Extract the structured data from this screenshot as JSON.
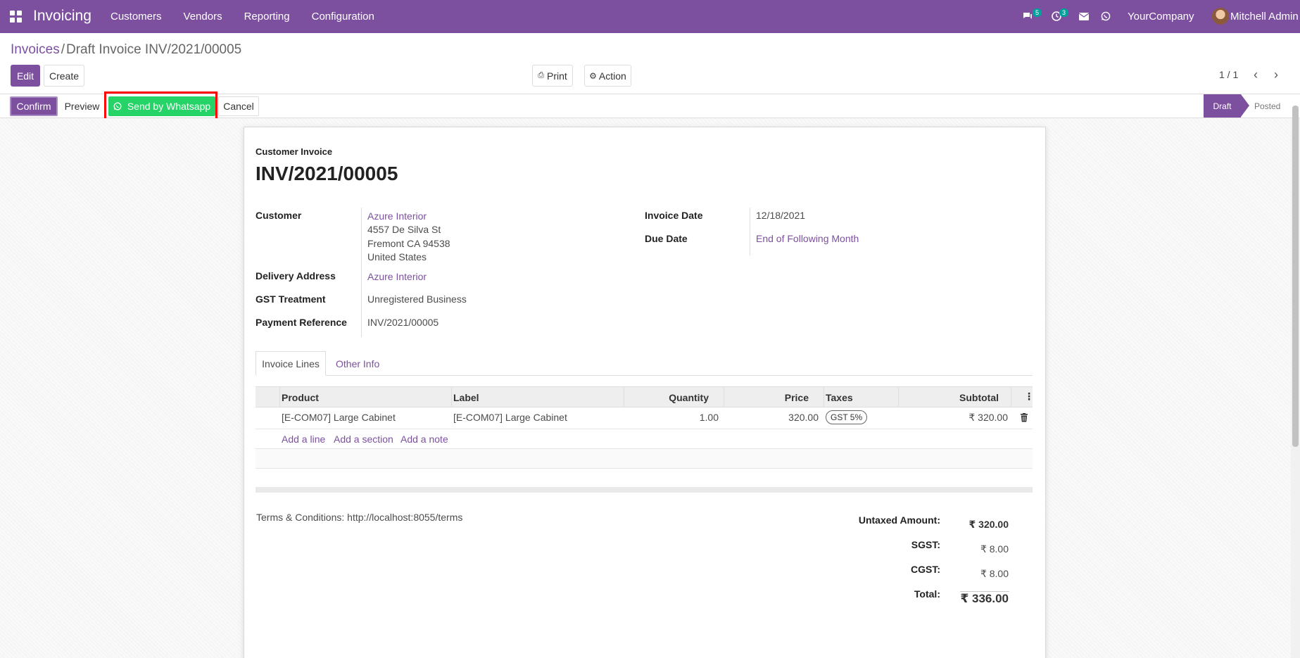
{
  "navbar": {
    "app_title": "Invoicing",
    "menu": [
      "Customers",
      "Vendors",
      "Reporting",
      "Configuration"
    ],
    "chat_badge": "5",
    "activity_badge": "3",
    "company": "YourCompany",
    "user": "Mitchell Admin"
  },
  "breadcrumb": {
    "parent": "Invoices",
    "separator": "/",
    "current": "Draft Invoice INV/2021/00005"
  },
  "control": {
    "edit": "Edit",
    "create": "Create",
    "print": "Print",
    "action": "Action",
    "pager": "1 / 1"
  },
  "statusbar": {
    "confirm": "Confirm",
    "preview": "Preview",
    "whatsapp": "Send by Whatsapp",
    "cancel": "Cancel",
    "stages": [
      "Draft",
      "Posted"
    ]
  },
  "invoice": {
    "type": "Customer Invoice",
    "number": "INV/2021/00005",
    "fields": {
      "customer_label": "Customer",
      "customer_name": "Azure Interior",
      "address": [
        "4557 De Silva St",
        "Fremont CA 94538",
        "United States"
      ],
      "delivery_label": "Delivery Address",
      "delivery_value": "Azure Interior",
      "gst_label": "GST Treatment",
      "gst_value": "Unregistered Business",
      "payref_label": "Payment Reference",
      "payref_value": "INV/2021/00005",
      "invdate_label": "Invoice Date",
      "invdate_value": "12/18/2021",
      "duedate_label": "Due Date",
      "duedate_value": "End of Following Month"
    },
    "tabs": [
      "Invoice Lines",
      "Other Info"
    ],
    "table": {
      "headers": [
        "Product",
        "Label",
        "Quantity",
        "Price",
        "Taxes",
        "Subtotal"
      ],
      "rows": [
        {
          "product": "[E-COM07] Large Cabinet",
          "label": "[E-COM07] Large Cabinet",
          "quantity": "1.00",
          "price": "320.00",
          "tax": "GST 5%",
          "subtotal": "₹ 320.00"
        }
      ],
      "add_line": "Add a line",
      "add_section": "Add a section",
      "add_note": "Add a note"
    },
    "terms": "Terms & Conditions: http://localhost:8055/terms",
    "totals": {
      "untaxed_label": "Untaxed Amount:",
      "untaxed_value": "₹ 320.00",
      "sgst_label": "SGST:",
      "sgst_value": "₹ 8.00",
      "cgst_label": "CGST:",
      "cgst_value": "₹ 8.00",
      "total_label": "Total:",
      "total_value": "₹ 336.00"
    }
  }
}
